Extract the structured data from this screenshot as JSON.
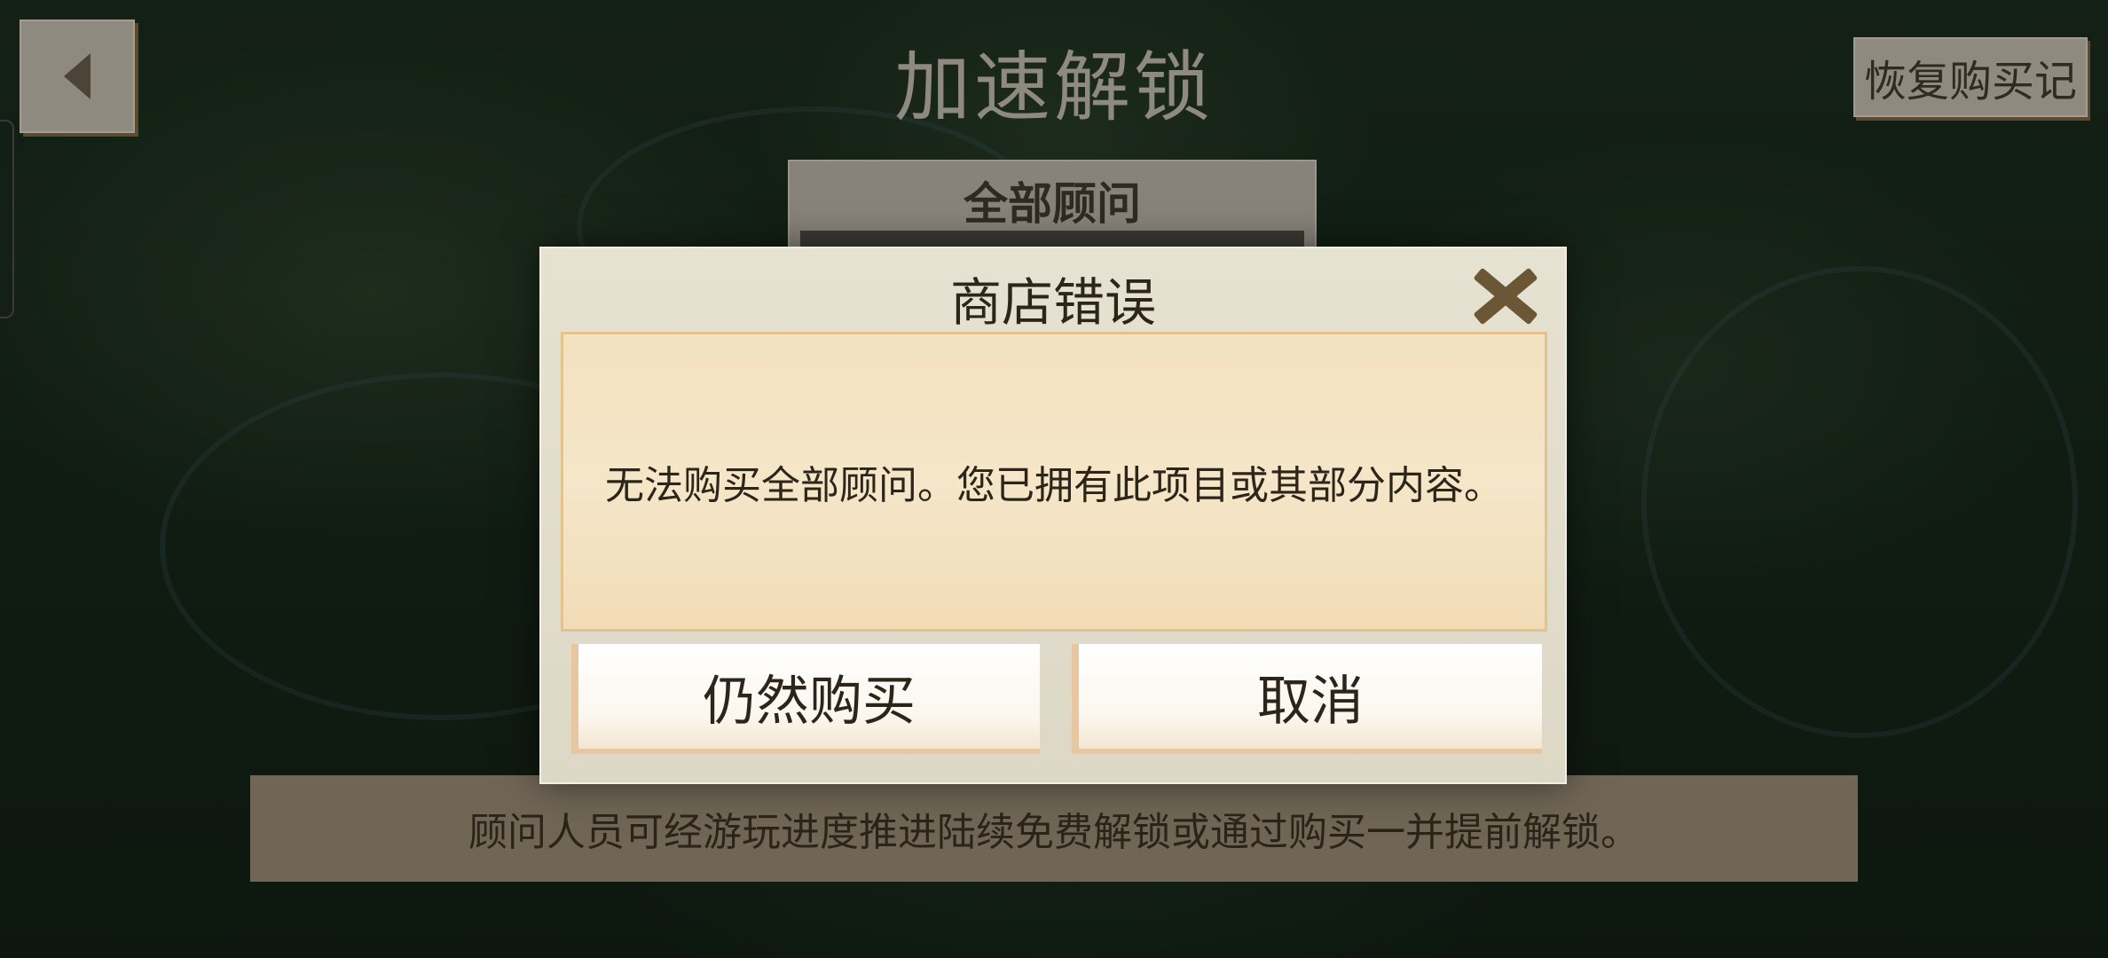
{
  "screen": {
    "title": "加速解锁",
    "restore_label": "恢复购买记",
    "pack_title": "全部顾问",
    "info_text": "顾问人员可经游玩进度推进陆续免费解锁或通过购买一并提前解锁。"
  },
  "dialog": {
    "title": "商店错误",
    "message": "无法购买全部顾问。您已拥有此项目或其部分内容。",
    "buy_label": "仍然购买",
    "cancel_label": "取消"
  },
  "icons": [
    "back-arrow-icon",
    "close-icon"
  ],
  "colors": {
    "dialog_bg": "#e6e2d2",
    "message_bg": "#f3e1bf",
    "accent_brown": "#6b5636"
  }
}
